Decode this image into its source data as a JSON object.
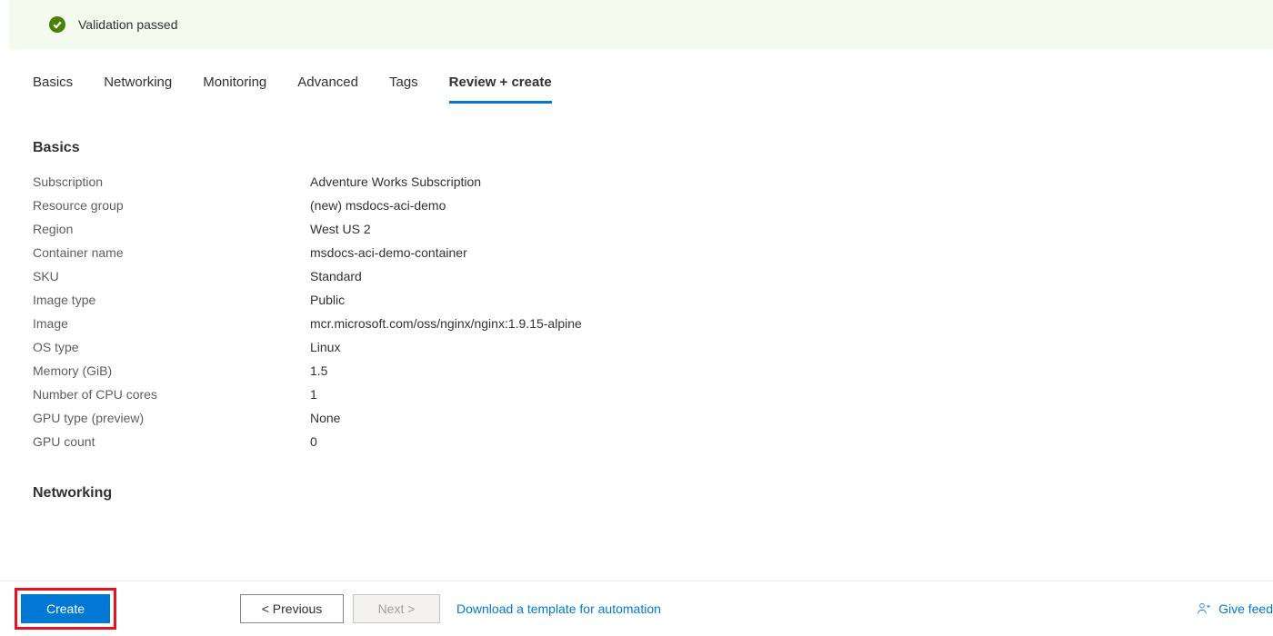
{
  "validation": {
    "message": "Validation passed"
  },
  "tabs": [
    {
      "label": "Basics",
      "active": false
    },
    {
      "label": "Networking",
      "active": false
    },
    {
      "label": "Monitoring",
      "active": false
    },
    {
      "label": "Advanced",
      "active": false
    },
    {
      "label": "Tags",
      "active": false
    },
    {
      "label": "Review + create",
      "active": true
    }
  ],
  "sections": {
    "basics": {
      "title": "Basics",
      "rows": [
        {
          "key": "Subscription",
          "val": "Adventure Works Subscription"
        },
        {
          "key": "Resource group",
          "val": "(new) msdocs-aci-demo"
        },
        {
          "key": "Region",
          "val": "West US 2"
        },
        {
          "key": "Container name",
          "val": "msdocs-aci-demo-container"
        },
        {
          "key": "SKU",
          "val": "Standard"
        },
        {
          "key": "Image type",
          "val": "Public"
        },
        {
          "key": "Image",
          "val": "mcr.microsoft.com/oss/nginx/nginx:1.9.15-alpine"
        },
        {
          "key": "OS type",
          "val": "Linux"
        },
        {
          "key": "Memory (GiB)",
          "val": "1.5"
        },
        {
          "key": "Number of CPU cores",
          "val": "1"
        },
        {
          "key": "GPU type (preview)",
          "val": "None"
        },
        {
          "key": "GPU count",
          "val": "0"
        }
      ]
    },
    "networking": {
      "title": "Networking"
    }
  },
  "footer": {
    "create": "Create",
    "previous": "< Previous",
    "next": "Next >",
    "download_link": "Download a template for automation",
    "feedback": "Give feed"
  }
}
